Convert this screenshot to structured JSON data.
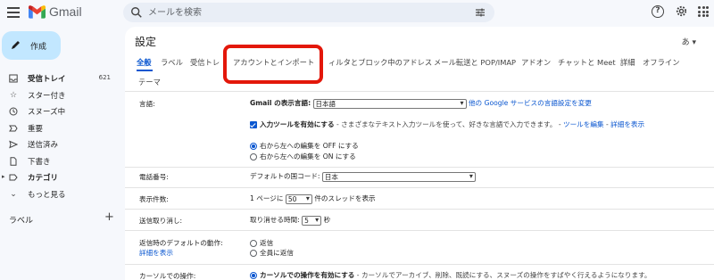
{
  "topbar": {
    "app_name": "Gmail",
    "search_placeholder": "メールを検索"
  },
  "sidebar": {
    "compose_label": "作成",
    "items": [
      {
        "icon": "inbox-icon",
        "label": "受信トレイ",
        "count": "621",
        "bold": true
      },
      {
        "icon": "star-icon",
        "label": "スター付き",
        "count": ""
      },
      {
        "icon": "clock-icon",
        "label": "スヌーズ中",
        "count": ""
      },
      {
        "icon": "important-icon",
        "label": "重要",
        "count": ""
      },
      {
        "icon": "send-icon",
        "label": "送信済み",
        "count": ""
      },
      {
        "icon": "draft-icon",
        "label": "下書き",
        "count": ""
      },
      {
        "icon": "label-icon",
        "label": "カテゴリ",
        "count": "",
        "bold": true
      },
      {
        "icon": "chevron-down-icon",
        "label": "もっと見る",
        "count": ""
      }
    ],
    "labels_heading": "ラベル"
  },
  "main": {
    "title": "設定",
    "lang_switch": "あ",
    "tabs": [
      {
        "label": "全般",
        "active": true
      },
      {
        "label": "ラベル"
      },
      {
        "label": "受信トレ"
      },
      {
        "label": "アカウントとインポート"
      },
      {
        "label": "ィルタとブロック中のアドレス"
      },
      {
        "label": "メール転送と POP/IMAP"
      },
      {
        "label": "アドオン"
      },
      {
        "label": "チャットと Meet"
      },
      {
        "label": "詳細"
      },
      {
        "label": "オフライン"
      },
      {
        "label": "テーマ"
      }
    ],
    "language": {
      "label": "言語:",
      "display_lang_label": "Gmail の表示言語:",
      "display_lang_value": "日本語",
      "other_lang_link": "他の Google サービスの言語設定を変更",
      "input_tools_label": "入力ツールを有効にする",
      "input_tools_desc": " - さまざまなテキスト入力ツールを使って、好きな言語で入力できます。 - ",
      "edit_tools_link": "ツールを編集",
      "sep": " - ",
      "details_link": "詳細を表示",
      "rtl_off": "右から左への編集を OFF にする",
      "rtl_on": "右から左への編集を ON にする"
    },
    "phone": {
      "label": "電話番号:",
      "country_label": "デフォルトの国コード:",
      "country_value": "日本"
    },
    "page_size": {
      "label": "表示件数:",
      "prefix": "1 ページに",
      "value": "50",
      "suffix": "件のスレッドを表示"
    },
    "undo_send": {
      "label": "送信取り消し:",
      "prefix": "取り消せる時間:",
      "value": "5",
      "suffix": "秒"
    },
    "reply_default": {
      "label": "返信時のデフォルトの動作:",
      "link": "詳細を表示",
      "opt_reply": "返信",
      "opt_reply_all": "全員に返信"
    },
    "cursor": {
      "label": "カーソルでの操作:",
      "option_label": "カーソルでの操作を有効にする",
      "option_desc": " - カーソルでアーカイブ、削除、既読にする、スヌーズの操作をすばやく行えるようになります。"
    }
  },
  "colors": {
    "accent": "#0b57d0",
    "highlight": "#e3170a",
    "compose_bg": "#c2e7ff"
  }
}
